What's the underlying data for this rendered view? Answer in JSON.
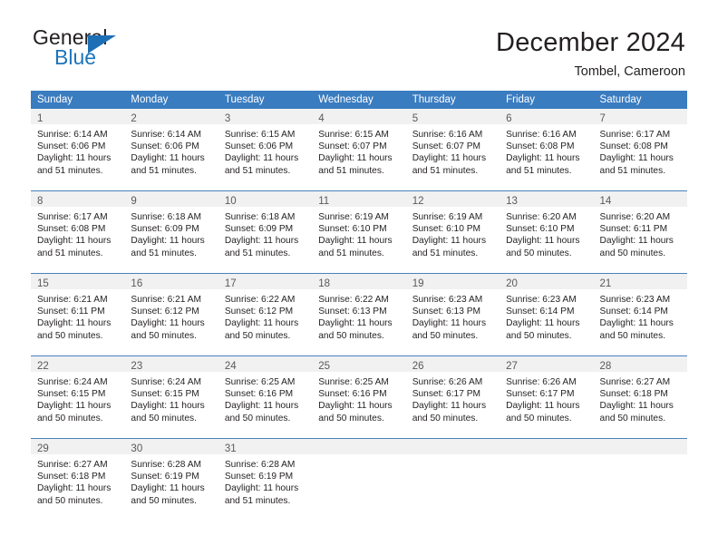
{
  "brand": {
    "name_part1": "General",
    "name_part2": "Blue",
    "triangle_color": "#1c6fb5",
    "blue_text_color": "#1c75bc"
  },
  "header": {
    "title": "December 2024",
    "subtitle": "Tombel, Cameroon"
  },
  "colors": {
    "header_row_bg": "#3a7cc0",
    "day_band_bg": "#f1f1f1",
    "week_separator": "#4a82bf",
    "body_text": "#231f20",
    "day_number_text": "#58595b"
  },
  "weekdays": [
    "Sunday",
    "Monday",
    "Tuesday",
    "Wednesday",
    "Thursday",
    "Friday",
    "Saturday"
  ],
  "weeks": [
    [
      {
        "day": "1",
        "sunrise": "Sunrise: 6:14 AM",
        "sunset": "Sunset: 6:06 PM",
        "daylight1": "Daylight: 11 hours",
        "daylight2": "and 51 minutes."
      },
      {
        "day": "2",
        "sunrise": "Sunrise: 6:14 AM",
        "sunset": "Sunset: 6:06 PM",
        "daylight1": "Daylight: 11 hours",
        "daylight2": "and 51 minutes."
      },
      {
        "day": "3",
        "sunrise": "Sunrise: 6:15 AM",
        "sunset": "Sunset: 6:06 PM",
        "daylight1": "Daylight: 11 hours",
        "daylight2": "and 51 minutes."
      },
      {
        "day": "4",
        "sunrise": "Sunrise: 6:15 AM",
        "sunset": "Sunset: 6:07 PM",
        "daylight1": "Daylight: 11 hours",
        "daylight2": "and 51 minutes."
      },
      {
        "day": "5",
        "sunrise": "Sunrise: 6:16 AM",
        "sunset": "Sunset: 6:07 PM",
        "daylight1": "Daylight: 11 hours",
        "daylight2": "and 51 minutes."
      },
      {
        "day": "6",
        "sunrise": "Sunrise: 6:16 AM",
        "sunset": "Sunset: 6:08 PM",
        "daylight1": "Daylight: 11 hours",
        "daylight2": "and 51 minutes."
      },
      {
        "day": "7",
        "sunrise": "Sunrise: 6:17 AM",
        "sunset": "Sunset: 6:08 PM",
        "daylight1": "Daylight: 11 hours",
        "daylight2": "and 51 minutes."
      }
    ],
    [
      {
        "day": "8",
        "sunrise": "Sunrise: 6:17 AM",
        "sunset": "Sunset: 6:08 PM",
        "daylight1": "Daylight: 11 hours",
        "daylight2": "and 51 minutes."
      },
      {
        "day": "9",
        "sunrise": "Sunrise: 6:18 AM",
        "sunset": "Sunset: 6:09 PM",
        "daylight1": "Daylight: 11 hours",
        "daylight2": "and 51 minutes."
      },
      {
        "day": "10",
        "sunrise": "Sunrise: 6:18 AM",
        "sunset": "Sunset: 6:09 PM",
        "daylight1": "Daylight: 11 hours",
        "daylight2": "and 51 minutes."
      },
      {
        "day": "11",
        "sunrise": "Sunrise: 6:19 AM",
        "sunset": "Sunset: 6:10 PM",
        "daylight1": "Daylight: 11 hours",
        "daylight2": "and 51 minutes."
      },
      {
        "day": "12",
        "sunrise": "Sunrise: 6:19 AM",
        "sunset": "Sunset: 6:10 PM",
        "daylight1": "Daylight: 11 hours",
        "daylight2": "and 51 minutes."
      },
      {
        "day": "13",
        "sunrise": "Sunrise: 6:20 AM",
        "sunset": "Sunset: 6:10 PM",
        "daylight1": "Daylight: 11 hours",
        "daylight2": "and 50 minutes."
      },
      {
        "day": "14",
        "sunrise": "Sunrise: 6:20 AM",
        "sunset": "Sunset: 6:11 PM",
        "daylight1": "Daylight: 11 hours",
        "daylight2": "and 50 minutes."
      }
    ],
    [
      {
        "day": "15",
        "sunrise": "Sunrise: 6:21 AM",
        "sunset": "Sunset: 6:11 PM",
        "daylight1": "Daylight: 11 hours",
        "daylight2": "and 50 minutes."
      },
      {
        "day": "16",
        "sunrise": "Sunrise: 6:21 AM",
        "sunset": "Sunset: 6:12 PM",
        "daylight1": "Daylight: 11 hours",
        "daylight2": "and 50 minutes."
      },
      {
        "day": "17",
        "sunrise": "Sunrise: 6:22 AM",
        "sunset": "Sunset: 6:12 PM",
        "daylight1": "Daylight: 11 hours",
        "daylight2": "and 50 minutes."
      },
      {
        "day": "18",
        "sunrise": "Sunrise: 6:22 AM",
        "sunset": "Sunset: 6:13 PM",
        "daylight1": "Daylight: 11 hours",
        "daylight2": "and 50 minutes."
      },
      {
        "day": "19",
        "sunrise": "Sunrise: 6:23 AM",
        "sunset": "Sunset: 6:13 PM",
        "daylight1": "Daylight: 11 hours",
        "daylight2": "and 50 minutes."
      },
      {
        "day": "20",
        "sunrise": "Sunrise: 6:23 AM",
        "sunset": "Sunset: 6:14 PM",
        "daylight1": "Daylight: 11 hours",
        "daylight2": "and 50 minutes."
      },
      {
        "day": "21",
        "sunrise": "Sunrise: 6:23 AM",
        "sunset": "Sunset: 6:14 PM",
        "daylight1": "Daylight: 11 hours",
        "daylight2": "and 50 minutes."
      }
    ],
    [
      {
        "day": "22",
        "sunrise": "Sunrise: 6:24 AM",
        "sunset": "Sunset: 6:15 PM",
        "daylight1": "Daylight: 11 hours",
        "daylight2": "and 50 minutes."
      },
      {
        "day": "23",
        "sunrise": "Sunrise: 6:24 AM",
        "sunset": "Sunset: 6:15 PM",
        "daylight1": "Daylight: 11 hours",
        "daylight2": "and 50 minutes."
      },
      {
        "day": "24",
        "sunrise": "Sunrise: 6:25 AM",
        "sunset": "Sunset: 6:16 PM",
        "daylight1": "Daylight: 11 hours",
        "daylight2": "and 50 minutes."
      },
      {
        "day": "25",
        "sunrise": "Sunrise: 6:25 AM",
        "sunset": "Sunset: 6:16 PM",
        "daylight1": "Daylight: 11 hours",
        "daylight2": "and 50 minutes."
      },
      {
        "day": "26",
        "sunrise": "Sunrise: 6:26 AM",
        "sunset": "Sunset: 6:17 PM",
        "daylight1": "Daylight: 11 hours",
        "daylight2": "and 50 minutes."
      },
      {
        "day": "27",
        "sunrise": "Sunrise: 6:26 AM",
        "sunset": "Sunset: 6:17 PM",
        "daylight1": "Daylight: 11 hours",
        "daylight2": "and 50 minutes."
      },
      {
        "day": "28",
        "sunrise": "Sunrise: 6:27 AM",
        "sunset": "Sunset: 6:18 PM",
        "daylight1": "Daylight: 11 hours",
        "daylight2": "and 50 minutes."
      }
    ],
    [
      {
        "day": "29",
        "sunrise": "Sunrise: 6:27 AM",
        "sunset": "Sunset: 6:18 PM",
        "daylight1": "Daylight: 11 hours",
        "daylight2": "and 50 minutes."
      },
      {
        "day": "30",
        "sunrise": "Sunrise: 6:28 AM",
        "sunset": "Sunset: 6:19 PM",
        "daylight1": "Daylight: 11 hours",
        "daylight2": "and 50 minutes."
      },
      {
        "day": "31",
        "sunrise": "Sunrise: 6:28 AM",
        "sunset": "Sunset: 6:19 PM",
        "daylight1": "Daylight: 11 hours",
        "daylight2": "and 51 minutes."
      },
      {
        "day": "",
        "sunrise": "",
        "sunset": "",
        "daylight1": "",
        "daylight2": ""
      },
      {
        "day": "",
        "sunrise": "",
        "sunset": "",
        "daylight1": "",
        "daylight2": ""
      },
      {
        "day": "",
        "sunrise": "",
        "sunset": "",
        "daylight1": "",
        "daylight2": ""
      },
      {
        "day": "",
        "sunrise": "",
        "sunset": "",
        "daylight1": "",
        "daylight2": ""
      }
    ]
  ]
}
